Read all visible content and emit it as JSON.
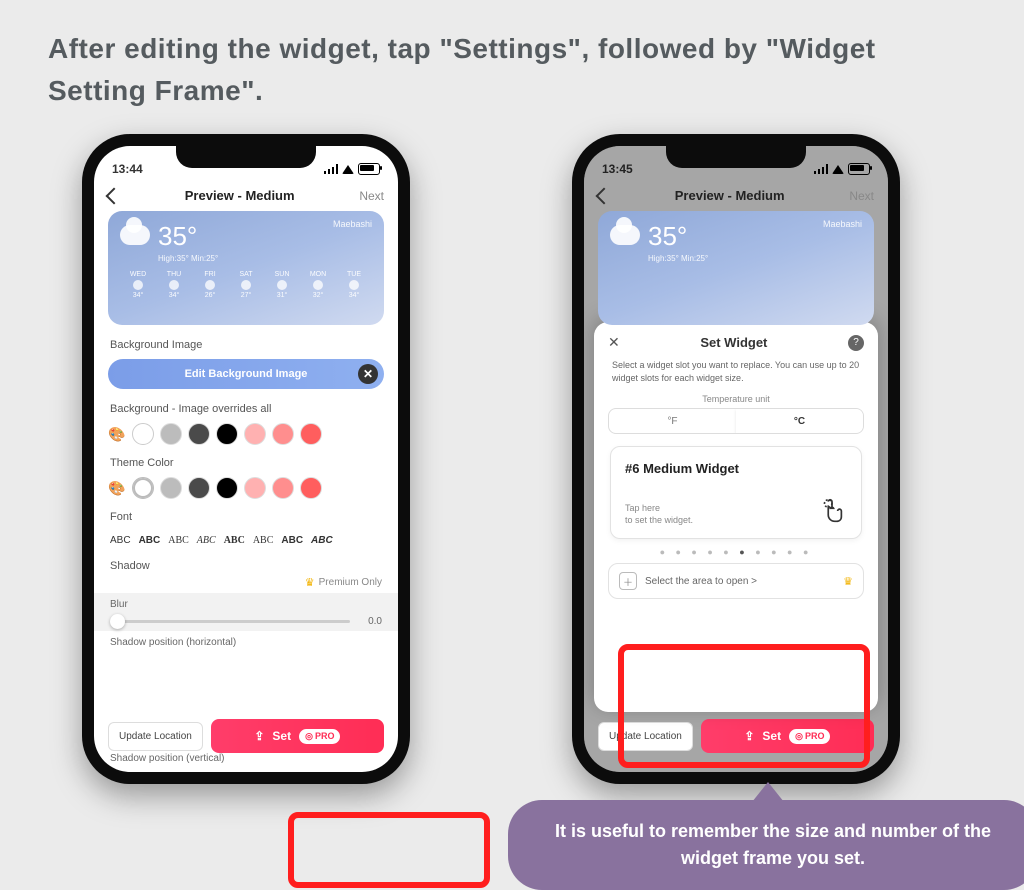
{
  "instruction": "After editing the widget, tap \"Settings\", followed by \"Widget Setting Frame\".",
  "bubble": "It is useful to remember the size and number of the widget frame you set.",
  "phone_left": {
    "time": "13:44",
    "nav_title": "Preview - Medium",
    "nav_next": "Next",
    "weather": {
      "location": "Maebashi",
      "temp": "35°",
      "hilo": "High:35° Min:25°",
      "days": [
        "WED",
        "THU",
        "FRI",
        "SAT",
        "SUN",
        "MON",
        "TUE"
      ],
      "day_temps": [
        "34°",
        "34°",
        "26°",
        "27°",
        "31°",
        "32°",
        "34°"
      ]
    },
    "labels": {
      "bg_image": "Background Image",
      "edit_bg": "Edit Background Image",
      "bg_override": "Background - Image overrides all",
      "theme": "Theme Color",
      "font": "Font",
      "shadow": "Shadow",
      "premium": "Premium Only",
      "blur": "Blur",
      "blur_val": "0.0",
      "shadow_h": "Shadow position (horizontal)",
      "shadow_v": "Shadow position (vertical)"
    },
    "swatches_bg": [
      "#ffffff",
      "#bcbcbc",
      "#4a4a4a",
      "#000000",
      "#ffb1b1",
      "#ff8e8e",
      "#ff5e5e"
    ],
    "swatches_theme": [
      "#ffffff",
      "#bcbcbc",
      "#4a4a4a",
      "#000000",
      "#ffb1b1",
      "#ff8e8e",
      "#ff5e5e"
    ],
    "fonts": [
      "ABC",
      "ABC",
      "ABC",
      "ABC",
      "ABC",
      "ABC",
      "ABC",
      "ABC"
    ],
    "bottom": {
      "update_loc": "Update Location",
      "set": "Set",
      "pro": "PRO"
    }
  },
  "phone_right": {
    "time": "13:45",
    "nav_title": "Preview - Medium",
    "nav_next": "Next",
    "sheet": {
      "title": "Set Widget",
      "desc": "Select a widget slot you want to replace. You can use up to 20 widget slots for each widget size.",
      "temp_unit_label": "Temperature unit",
      "unit_f": "°F",
      "unit_c": "°C",
      "slot_name": "#6 Medium Widget",
      "tap_here": "Tap here",
      "tap_here2": "to set the widget.",
      "open_area": "Select the area to open >"
    },
    "bottom": {
      "update_loc": "Update Location",
      "set": "Set",
      "pro": "PRO"
    }
  }
}
